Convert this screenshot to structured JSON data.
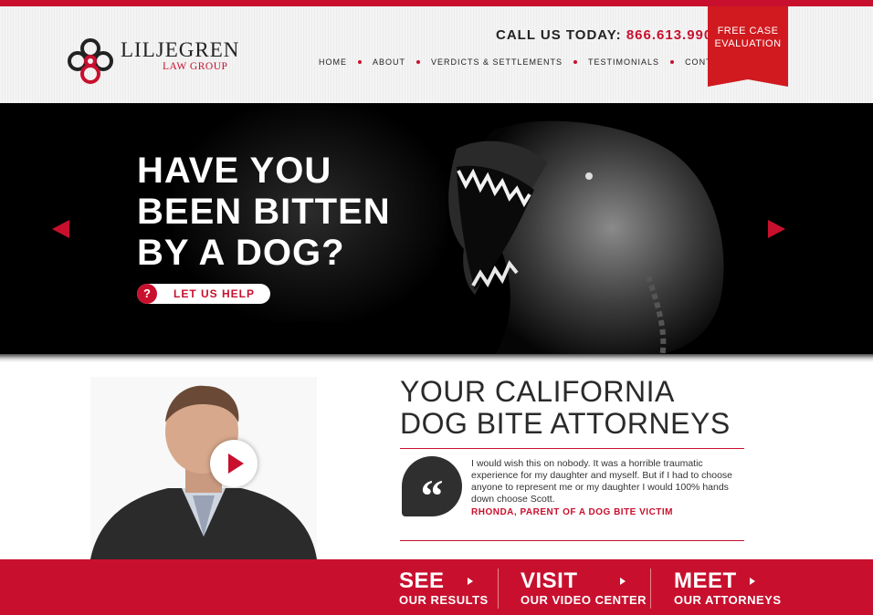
{
  "header": {
    "logo_name": "LILJEGREN",
    "logo_sub": "LAW GROUP",
    "phone_label": "CALL US TODAY:",
    "phone_number": "866.613.9906",
    "nav": [
      "HOME",
      "ABOUT",
      "VERDICTS & SETTLEMENTS",
      "TESTIMONIALS",
      "CONTACT US"
    ],
    "eval_line1": "FREE CASE",
    "eval_line2": "EVALUATION"
  },
  "hero": {
    "title_lines": [
      "HAVE YOU",
      "BEEN BITTEN",
      "BY A DOG?"
    ],
    "help_icon": "?",
    "help_label": "LET US HELP"
  },
  "main": {
    "title_lines": [
      "YOUR CALIFORNIA",
      "DOG BITE ATTORNEYS"
    ],
    "quote_mark": "“",
    "quote_text": "I would wish this on nobody. It was a horrible traumatic experience for my daughter and myself. But if I had to choose anyone to represent me or my daughter I would 100% hands down choose Scott.",
    "quote_author": "RHONDA, PARENT OF A DOG BITE VICTIM"
  },
  "footer": {
    "ctas": [
      {
        "big": "SEE",
        "small": "OUR RESULTS"
      },
      {
        "big": "VISIT",
        "small": "OUR VIDEO CENTER"
      },
      {
        "big": "MEET",
        "small": "OUR ATTORNEYS"
      }
    ]
  },
  "colors": {
    "brand_red": "#c8102e",
    "dark": "#2a2a2a",
    "hero_bg": "#000000"
  },
  "icons": [
    "logo-knot-icon",
    "question-icon",
    "arrow-left-icon",
    "arrow-right-icon",
    "play-icon",
    "quote-icon",
    "chevron-right-icon"
  ]
}
